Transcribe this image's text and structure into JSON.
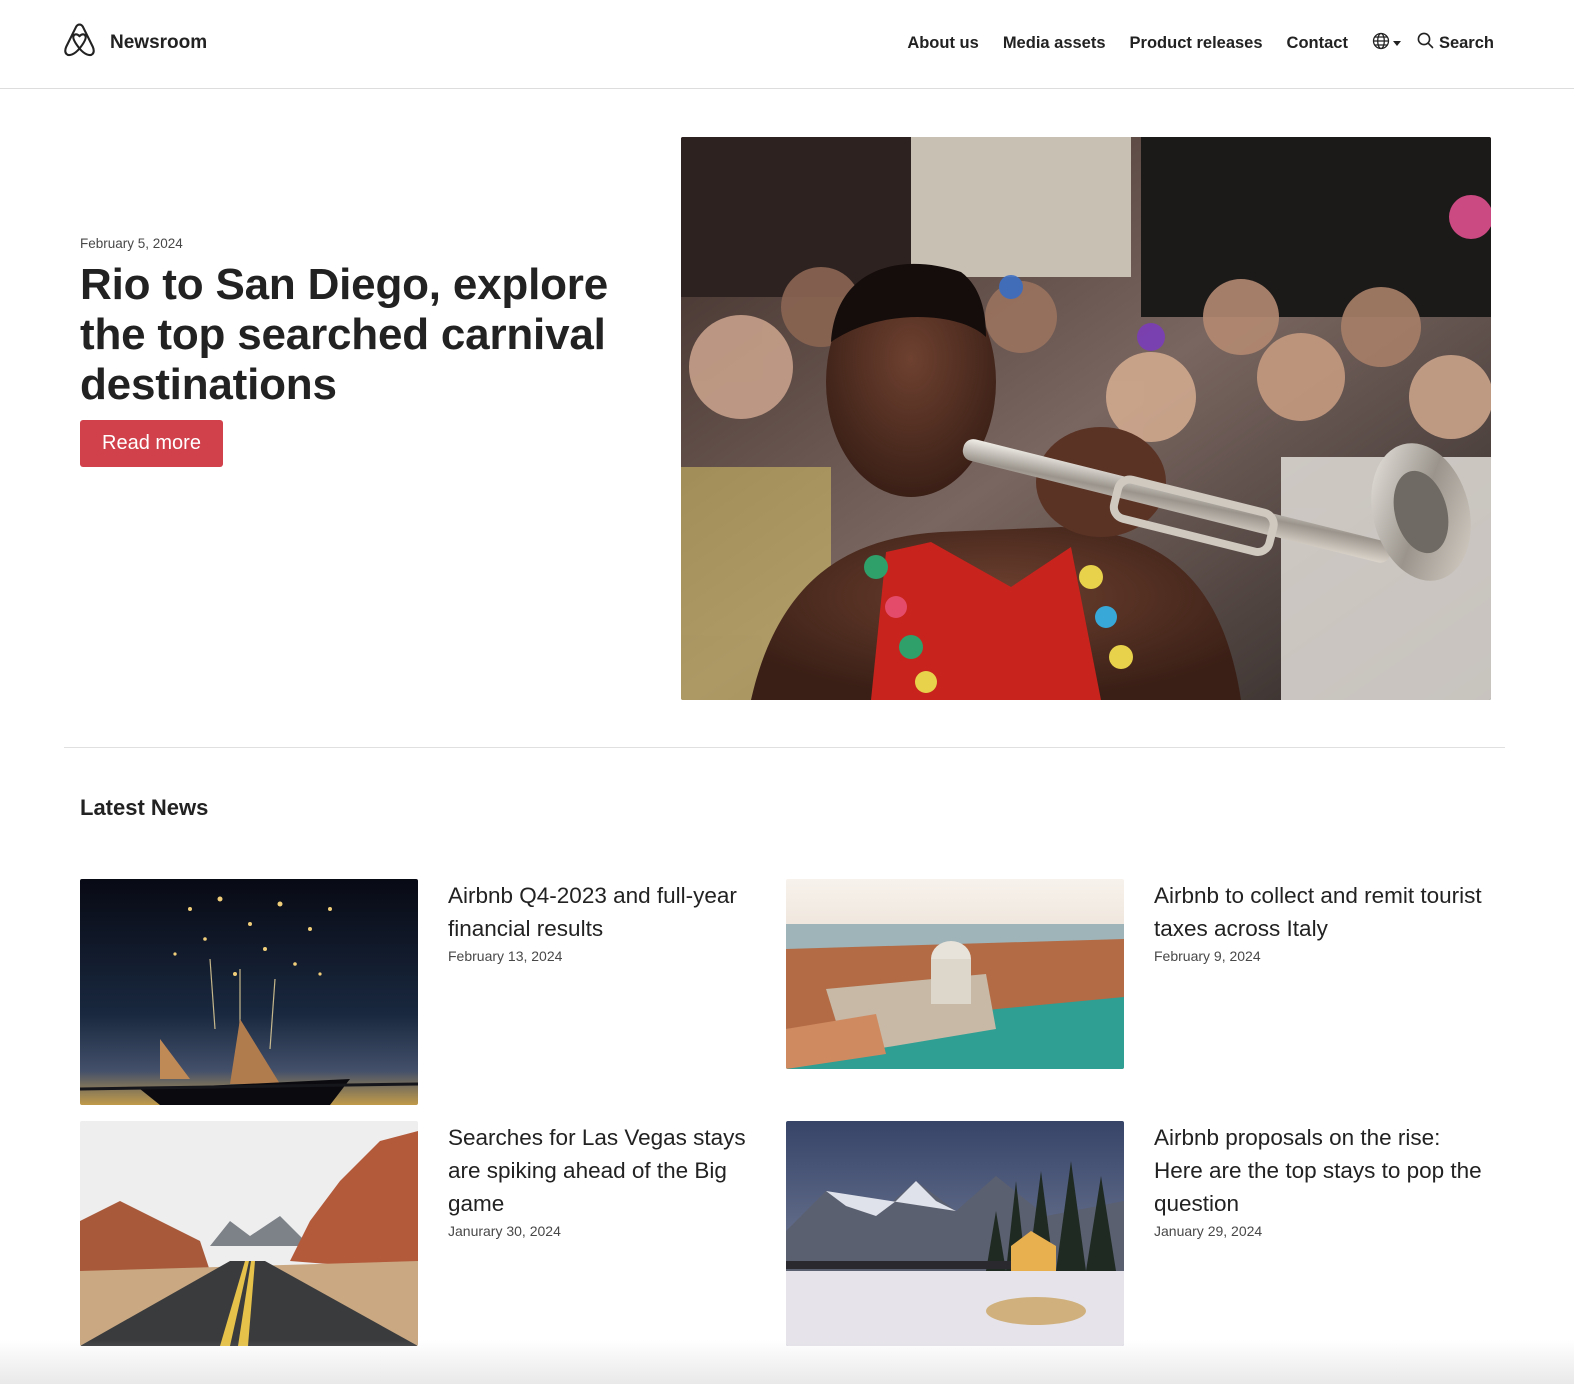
{
  "header": {
    "brand": "Newsroom",
    "nav": [
      {
        "label": "About us"
      },
      {
        "label": "Media assets"
      },
      {
        "label": "Product releases"
      },
      {
        "label": "Contact"
      }
    ],
    "search_label": "Search",
    "icons": {
      "logo": "airbnb-belo-icon",
      "language": "globe-icon",
      "search": "search-icon"
    }
  },
  "hero": {
    "date": "February 5, 2024",
    "title": "Rio to San Diego, explore the top searched carnival destinations",
    "button": "Read more",
    "button_color": "#d1414b",
    "image": "carnival-trumpet-player-photo"
  },
  "latest": {
    "title": "Latest News",
    "items": [
      {
        "title": "Airbnb Q4-2023 and full-year financial results",
        "date": "February 13, 2024",
        "image": "fireworks-boat-photo"
      },
      {
        "title": "Airbnb to collect and remit tourist taxes across Italy",
        "date": "February 9, 2024",
        "image": "venice-aerial-photo"
      },
      {
        "title": "Searches for Las Vegas stays are spiking ahead of the Big game",
        "date": "Janurary 30, 2024",
        "image": "desert-road-photo"
      },
      {
        "title": "Airbnb proposals on the rise: Here are the top stays to pop the question",
        "date": "January 29, 2024",
        "image": "snowy-lake-cabin-photo"
      }
    ]
  }
}
